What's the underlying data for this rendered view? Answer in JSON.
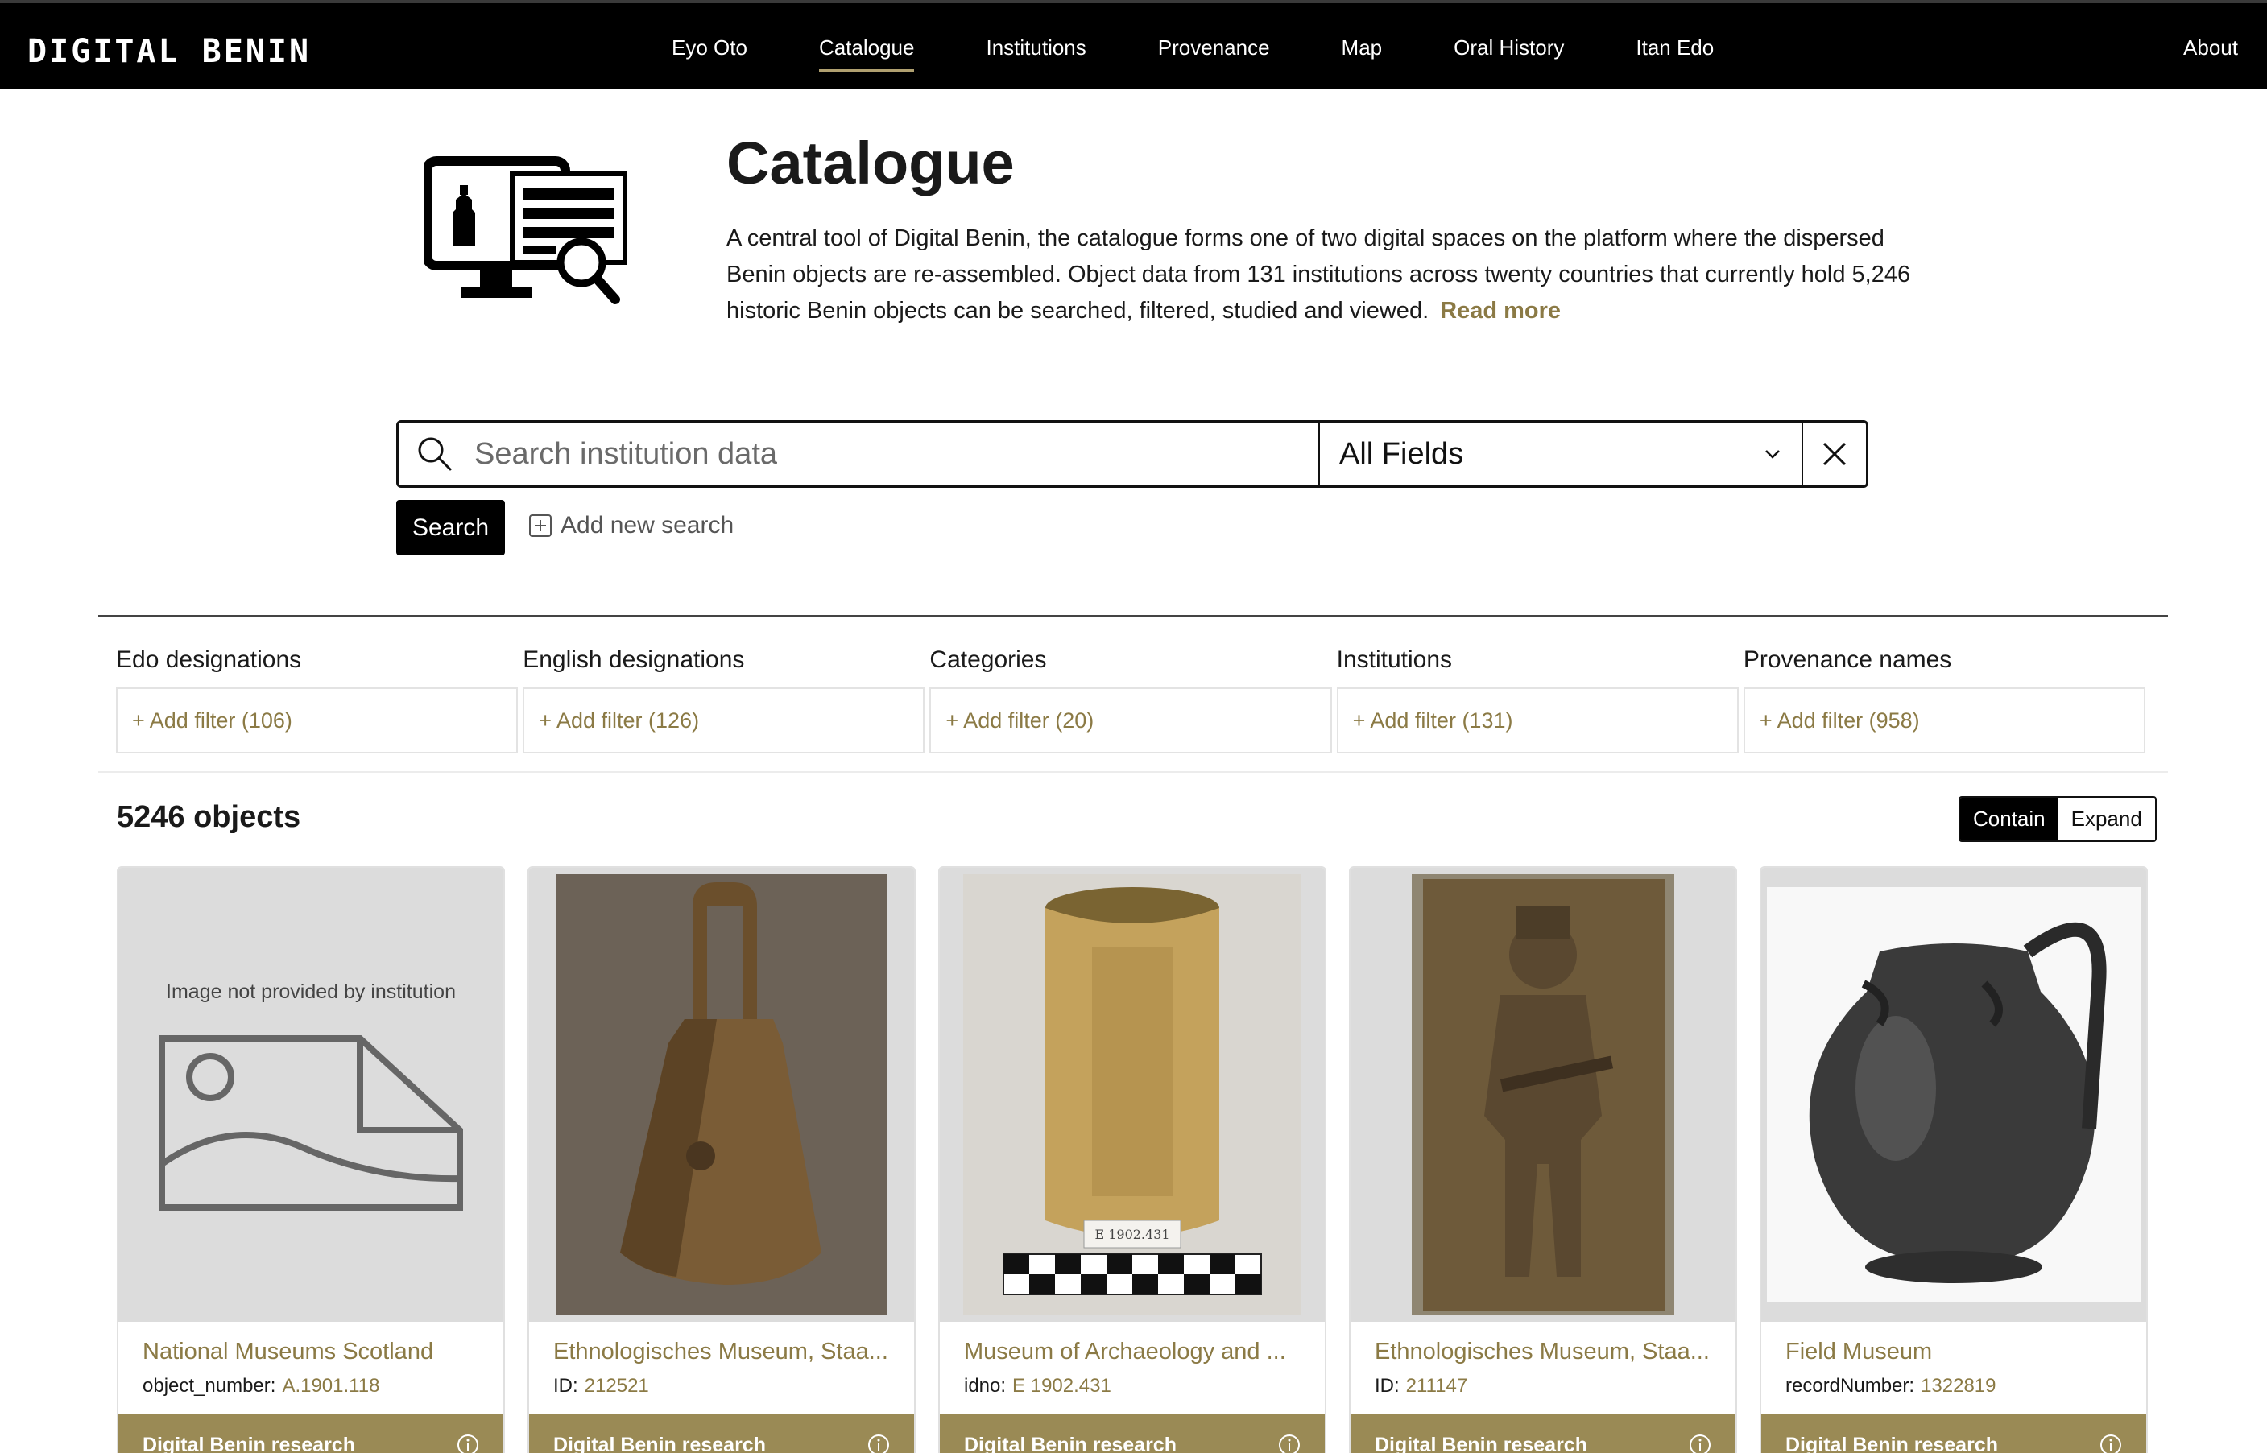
{
  "brand": {
    "logo": "DIGITAL BENIN"
  },
  "nav": {
    "items": [
      {
        "label": "Eyo Oto",
        "active": false
      },
      {
        "label": "Catalogue",
        "active": true
      },
      {
        "label": "Institutions",
        "active": false
      },
      {
        "label": "Provenance",
        "active": false
      },
      {
        "label": "Map",
        "active": false
      },
      {
        "label": "Oral History",
        "active": false
      },
      {
        "label": "Itan Edo",
        "active": false
      }
    ],
    "about": "About"
  },
  "hero": {
    "icon": "catalogue-computer-search-icon",
    "title": "Catalogue",
    "description": "A central tool of Digital Benin, the catalogue forms one of two digital spaces on the platform where the dispersed Benin objects are re-assembled. Object data from 131 institutions across twenty countries that currently hold 5,246 historic Benin objects can be searched, filtered, studied and viewed.",
    "read_more": "Read more"
  },
  "search": {
    "placeholder": "Search institution data",
    "field": "All Fields",
    "search_button": "Search",
    "add_new_search": "Add new search"
  },
  "filters": [
    {
      "label": "Edo designations",
      "action": "+ Add filter (106)"
    },
    {
      "label": "English designations",
      "action": "+ Add filter (126)"
    },
    {
      "label": "Categories",
      "action": "+ Add filter (20)"
    },
    {
      "label": "Institutions",
      "action": "+ Add filter (131)"
    },
    {
      "label": "Provenance names",
      "action": "+ Add filter (958)"
    }
  ],
  "results": {
    "count": "5246 objects",
    "view_options": [
      "Contain",
      "Expand"
    ],
    "active_view": "Contain"
  },
  "cards": [
    {
      "image": "no-image-placeholder",
      "image_text": "Image not provided by institution",
      "institution": "National Museums Scotland",
      "id_label": "object_number:",
      "id_value": "A.1901.118",
      "footer": "Digital Benin research"
    },
    {
      "image": "bronze-bell-photo",
      "institution": "Ethnologisches Museum, Staa...",
      "id_label": "ID:",
      "id_value": "212521",
      "footer": "Digital Benin research"
    },
    {
      "image": "ivory-cylinder-photo",
      "institution": "Museum of Archaeology and ...",
      "id_label": "idno:",
      "id_value": "E 1902.431",
      "footer": "Digital Benin research"
    },
    {
      "image": "bronze-plaque-photo",
      "institution": "Ethnologisches Museum, Staa...",
      "id_label": "ID:",
      "id_value": "211147",
      "footer": "Digital Benin research"
    },
    {
      "image": "ceramic-jug-photo",
      "institution": "Field Museum",
      "id_label": "recordNumber:",
      "id_value": "1322819",
      "footer": "Digital Benin research"
    }
  ],
  "colors": {
    "accent": "#8b7a45",
    "footer": "#9a8a55",
    "nav_bg": "#000000"
  }
}
